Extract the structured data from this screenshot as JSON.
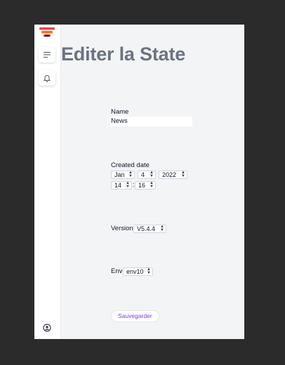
{
  "page": {
    "title": "Editer la State"
  },
  "sidebar": {
    "logo_icon": "stacked-bars-logo-icon",
    "menu_icon": "menu-lines-icon",
    "notifications_icon": "bell-icon",
    "user_icon": "user-circle-icon"
  },
  "form": {
    "name": {
      "label": "Name",
      "value": "News"
    },
    "created_date": {
      "label": "Created date",
      "month": "Jan",
      "day": "4",
      "year": "2022",
      "hour": "14",
      "minute": "16",
      "separator": ":"
    },
    "version": {
      "label": "Version",
      "value": "V5.4.4"
    },
    "env": {
      "label": "Env",
      "value": "env10"
    },
    "save_label": "Sauvegarder"
  },
  "colors": {
    "background": "#2b2b2b",
    "page": "#f3f4f6",
    "title": "#6b7280",
    "accent": "#7c3aed",
    "logo_red": "#ef4444",
    "logo_orange": "#f97316"
  }
}
